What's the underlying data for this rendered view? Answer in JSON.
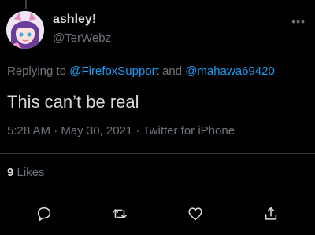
{
  "tweet": {
    "author": {
      "display_name": "ashley!",
      "handle": "@TerWebz"
    },
    "more_label": "•••",
    "replying": {
      "prefix": "Replying to ",
      "mention1": "@FirefoxSupport",
      "and": " and ",
      "mention2": "@mahawa69420"
    },
    "text": "This can’t be real",
    "meta": "5:28 AM · May 30, 2021 · Twitter for iPhone",
    "likes": {
      "count": "9",
      "label": "Likes"
    }
  },
  "actions": [
    {
      "name": "reply",
      "icon": "speech-bubble-icon"
    },
    {
      "name": "retweet",
      "icon": "retweet-icon"
    },
    {
      "name": "like",
      "icon": "heart-icon"
    },
    {
      "name": "share",
      "icon": "share-icon"
    }
  ],
  "colors": {
    "background": "#000000",
    "text": "#d9d9d9",
    "secondary": "#6e767d",
    "link": "#1d9bf0",
    "divider": "#2f3336"
  }
}
